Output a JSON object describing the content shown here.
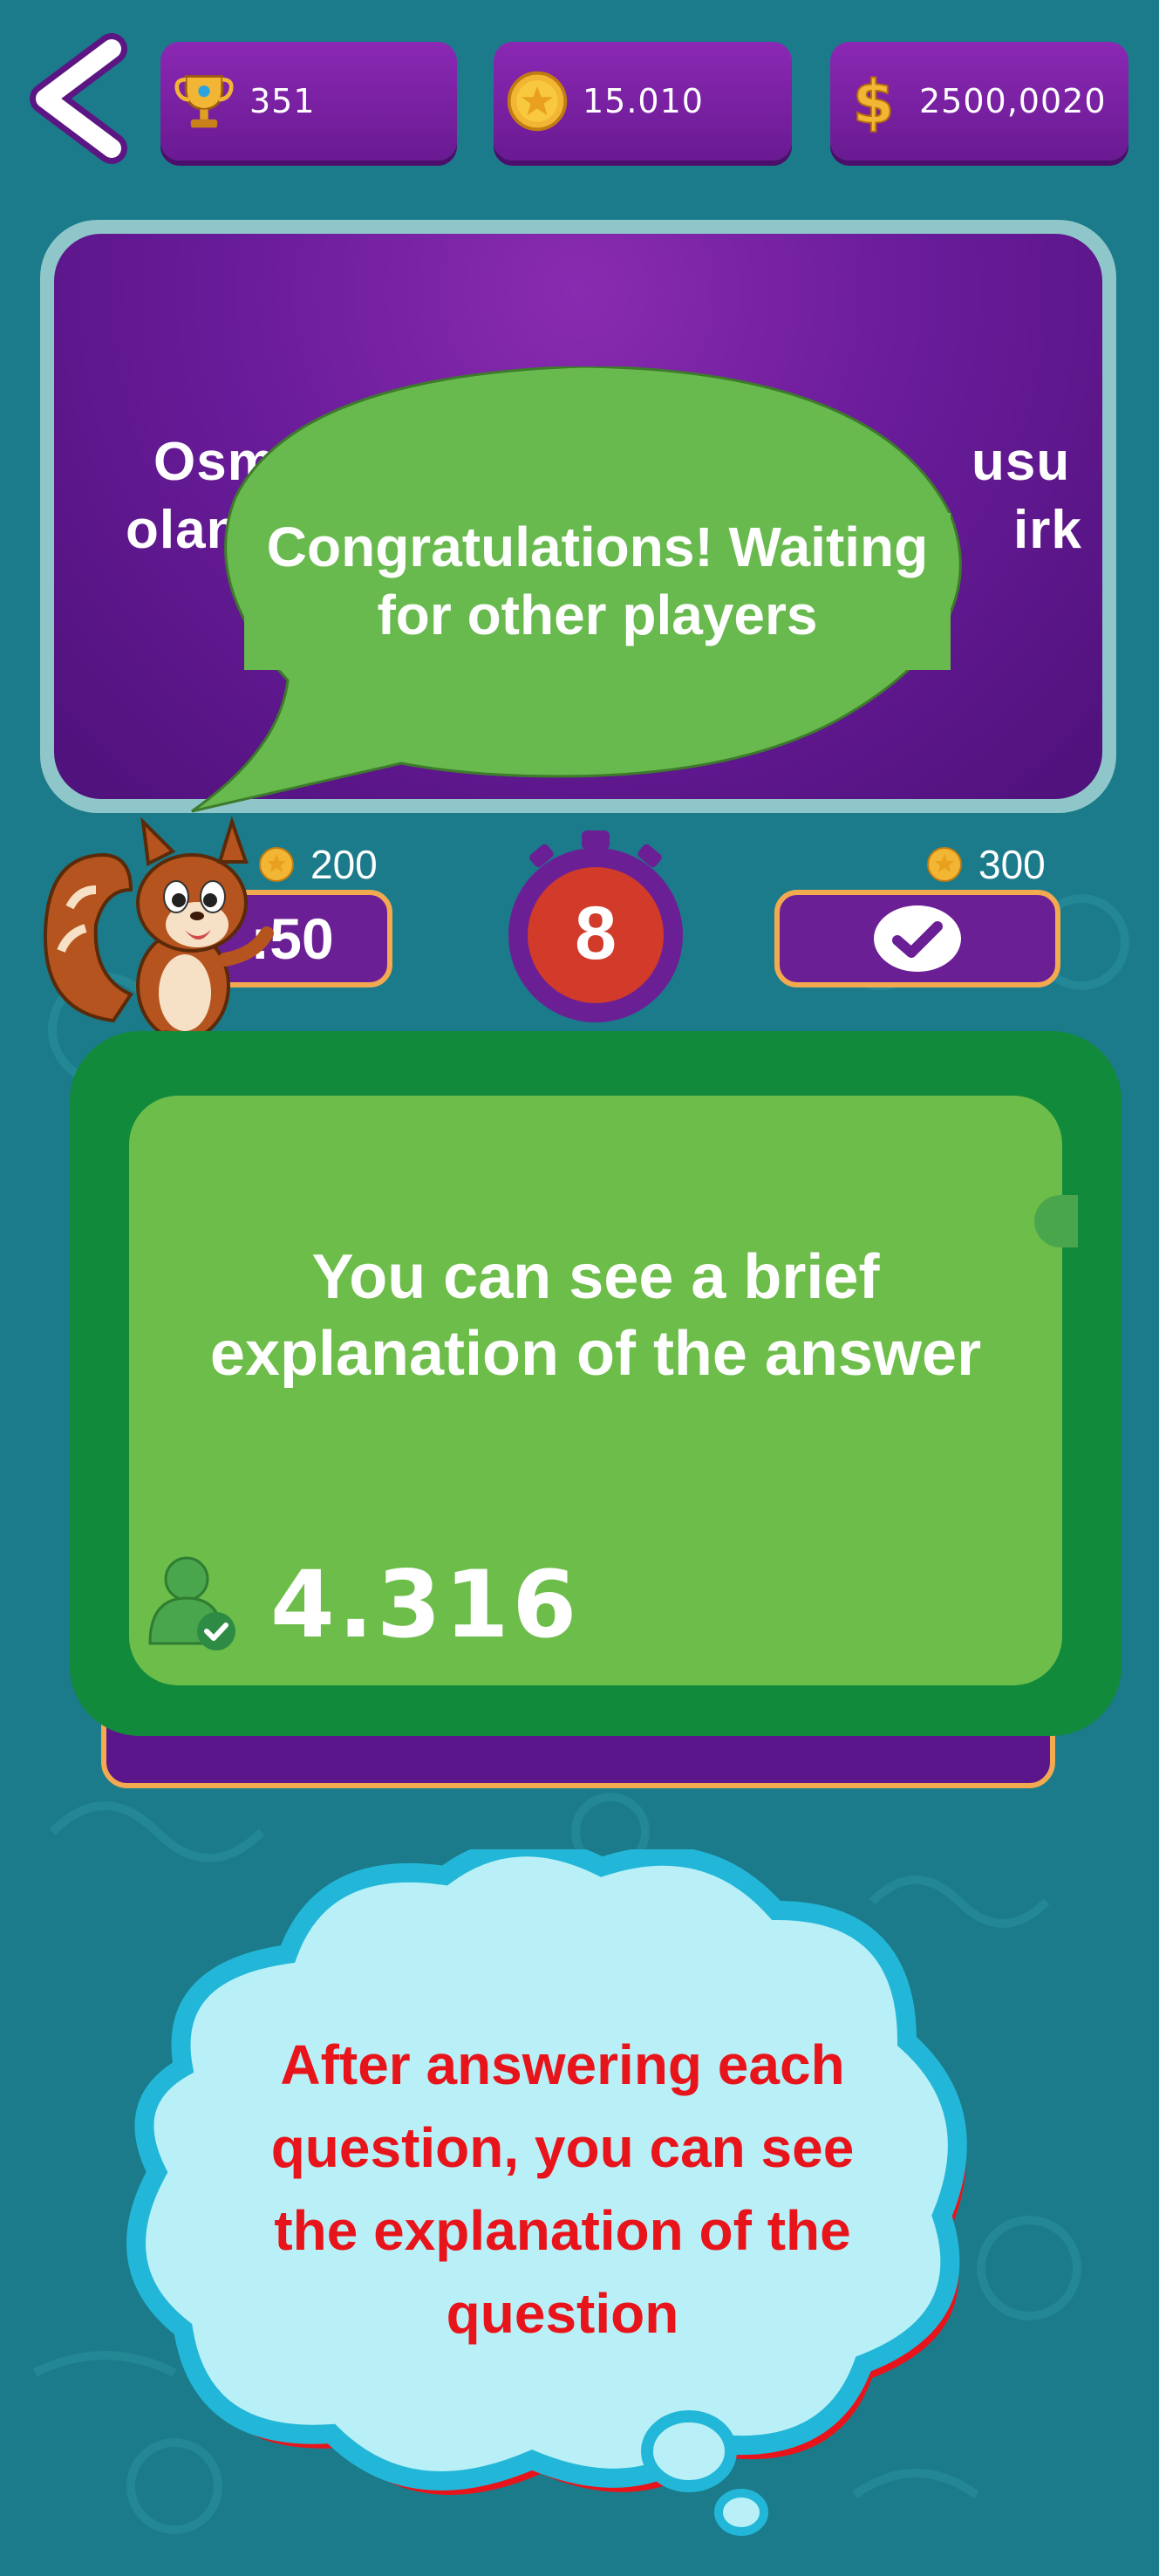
{
  "header": {
    "back_label": "Back",
    "trophies": "351",
    "coins": "15.010",
    "cash": "2500,0020"
  },
  "question": {
    "line1_left": "Osma",
    "line1_right": "usu",
    "line2_left": "olan",
    "line2_right": "irk"
  },
  "speech_bubble": {
    "text_line1": "Congratulations! Waiting",
    "text_line2": "for other players"
  },
  "lifelines": {
    "fifty_cost": "200",
    "fifty_label": ":50",
    "check_cost": "300"
  },
  "timer": {
    "value": "8"
  },
  "answer_card": {
    "text_line1": "You can see a brief",
    "text_line2": "explanation of the answer",
    "player_count": "4.316"
  },
  "tip_cloud": {
    "line1": "After answering each",
    "line2": "question, you can see",
    "line3": "the explanation of the",
    "line4": "question"
  },
  "colors": {
    "background": "#1b7b8a",
    "purple": "#6b1f95",
    "green_bubble": "#68b94e",
    "dark_green": "#128a3c",
    "orange_border": "#f2a94f",
    "cloud_blue": "#b9f0f7",
    "tip_red": "#e8141b"
  },
  "icons": [
    "back-chevron-icon",
    "trophy-icon",
    "gold-coin-icon",
    "dollar-icon",
    "stopwatch-icon",
    "checkmark-icon",
    "player-check-icon",
    "squirrel-mascot"
  ]
}
